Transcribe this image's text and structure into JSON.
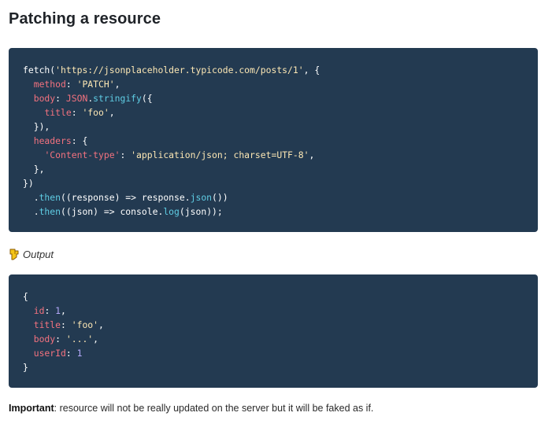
{
  "page": {
    "title": "Patching a resource"
  },
  "request_code": {
    "lines": [
      [
        {
          "t": "fetch(",
          "c": "plain"
        },
        {
          "t": "'https://jsonplaceholder.typicode.com/posts/1'",
          "c": "str"
        },
        {
          "t": ", {",
          "c": "plain"
        }
      ],
      [
        {
          "t": "  ",
          "c": "plain"
        },
        {
          "t": "method",
          "c": "kw-prop"
        },
        {
          "t": ": ",
          "c": "plain"
        },
        {
          "t": "'PATCH'",
          "c": "str"
        },
        {
          "t": ",",
          "c": "plain"
        }
      ],
      [
        {
          "t": "  ",
          "c": "plain"
        },
        {
          "t": "body",
          "c": "kw-prop"
        },
        {
          "t": ": ",
          "c": "plain"
        },
        {
          "t": "JSON",
          "c": "kw-prop"
        },
        {
          "t": ".",
          "c": "plain"
        },
        {
          "t": "stringify",
          "c": "fn"
        },
        {
          "t": "({",
          "c": "plain"
        }
      ],
      [
        {
          "t": "    ",
          "c": "plain"
        },
        {
          "t": "title",
          "c": "kw-prop"
        },
        {
          "t": ": ",
          "c": "plain"
        },
        {
          "t": "'foo'",
          "c": "str"
        },
        {
          "t": ",",
          "c": "plain"
        }
      ],
      [
        {
          "t": "  }),",
          "c": "plain"
        }
      ],
      [
        {
          "t": "  ",
          "c": "plain"
        },
        {
          "t": "headers",
          "c": "kw-prop"
        },
        {
          "t": ": {",
          "c": "plain"
        }
      ],
      [
        {
          "t": "    ",
          "c": "plain"
        },
        {
          "t": "'Content-type'",
          "c": "kw-prop"
        },
        {
          "t": ": ",
          "c": "plain"
        },
        {
          "t": "'application/json; charset=UTF-8'",
          "c": "str"
        },
        {
          "t": ",",
          "c": "plain"
        }
      ],
      [
        {
          "t": "  },",
          "c": "plain"
        }
      ],
      [
        {
          "t": "})",
          "c": "plain"
        }
      ],
      [
        {
          "t": "  .",
          "c": "plain"
        },
        {
          "t": "then",
          "c": "fn"
        },
        {
          "t": "((response) => response.",
          "c": "plain"
        },
        {
          "t": "json",
          "c": "fn"
        },
        {
          "t": "())",
          "c": "plain"
        }
      ],
      [
        {
          "t": "  .",
          "c": "plain"
        },
        {
          "t": "then",
          "c": "fn"
        },
        {
          "t": "((json) => console.",
          "c": "plain"
        },
        {
          "t": "log",
          "c": "fn"
        },
        {
          "t": "(json));",
          "c": "plain"
        }
      ]
    ]
  },
  "output_label": {
    "text": "Output",
    "icon": "pointing-hand-icon"
  },
  "output_code": {
    "lines": [
      [
        {
          "t": "{",
          "c": "plain"
        }
      ],
      [
        {
          "t": "  ",
          "c": "plain"
        },
        {
          "t": "id",
          "c": "kw-prop"
        },
        {
          "t": ": ",
          "c": "plain"
        },
        {
          "t": "1",
          "c": "num"
        },
        {
          "t": ",",
          "c": "plain"
        }
      ],
      [
        {
          "t": "  ",
          "c": "plain"
        },
        {
          "t": "title",
          "c": "kw-prop"
        },
        {
          "t": ": ",
          "c": "plain"
        },
        {
          "t": "'foo'",
          "c": "str"
        },
        {
          "t": ",",
          "c": "plain"
        }
      ],
      [
        {
          "t": "  ",
          "c": "plain"
        },
        {
          "t": "body",
          "c": "kw-prop"
        },
        {
          "t": ": ",
          "c": "plain"
        },
        {
          "t": "'...'",
          "c": "str"
        },
        {
          "t": ",",
          "c": "plain"
        }
      ],
      [
        {
          "t": "  ",
          "c": "plain"
        },
        {
          "t": "userId",
          "c": "kw-prop"
        },
        {
          "t": ": ",
          "c": "plain"
        },
        {
          "t": "1",
          "c": "num"
        }
      ],
      [
        {
          "t": "}",
          "c": "plain"
        }
      ]
    ]
  },
  "note": {
    "bold": "Important",
    "text": ": resource will not be really updated on the server but it will be faked as if."
  },
  "colors": {
    "code_background": "#233a51",
    "property": "#f3727f",
    "string": "#fce7b4",
    "function": "#5fcde4",
    "number": "#b5a9fa",
    "icon_fill": "#f5c518"
  }
}
